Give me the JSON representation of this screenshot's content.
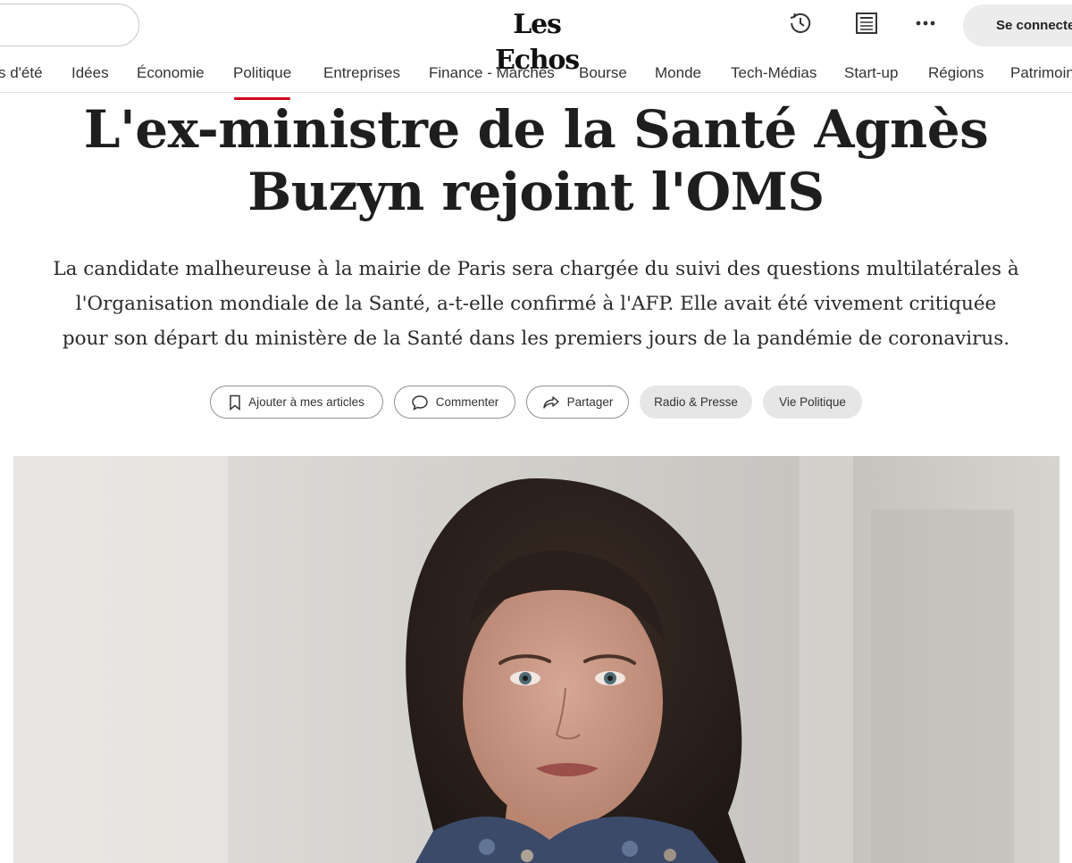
{
  "header": {
    "logo_text": "Les Echos",
    "connect_label": "Se connecter",
    "icons": [
      "history-icon",
      "journal-icon",
      "more-icon"
    ]
  },
  "nav": {
    "items": [
      {
        "label": "s d'été"
      },
      {
        "label": "Idées"
      },
      {
        "label": "Économie"
      },
      {
        "label": "Politique",
        "active": true
      },
      {
        "label": "Entreprises"
      },
      {
        "label": "Finance - Marchés"
      },
      {
        "label": "Bourse"
      },
      {
        "label": "Monde"
      },
      {
        "label": "Tech-Médias"
      },
      {
        "label": "Start-up"
      },
      {
        "label": "Régions"
      },
      {
        "label": "Patrimoine"
      }
    ],
    "active_color": "#d0021b"
  },
  "article": {
    "headline": {
      "line1": "L'ex-ministre de la Santé Agnès",
      "line2": "Buzyn rejoint l'OMS"
    },
    "lede": {
      "line1": "La candidate malheureuse à la mairie de Paris sera chargée du suivi des questions multilatérales à",
      "line2": "l'Organisation mondiale de la Santé, a-t-elle confirmé à l'AFP. Elle avait été vivement critiquée",
      "line3": "pour son départ du ministère de la Santé dans les premiers jours de la pandémie de coronavirus."
    },
    "actions": {
      "save_label": "Ajouter à mes articles",
      "comment_label": "Commenter",
      "share_label": "Partager",
      "tags": [
        "Radio & Presse",
        "Vie Politique"
      ]
    }
  }
}
